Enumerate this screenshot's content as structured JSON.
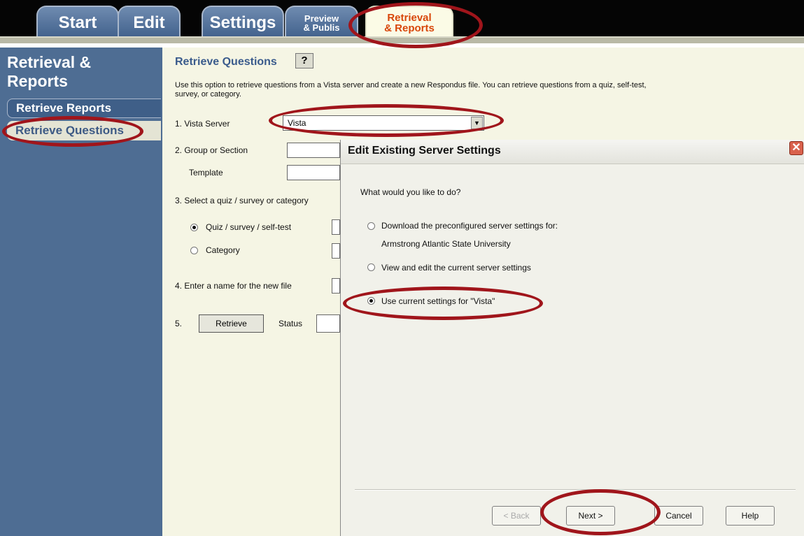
{
  "tabs": {
    "start": "Start",
    "edit": "Edit",
    "settings": "Settings",
    "preview_line1": "Preview",
    "preview_line2": "& Publis",
    "retrieval_line1": "Retrieval",
    "retrieval_line2": "& Reports"
  },
  "sidebar": {
    "heading_line1": "Retrieval &",
    "heading_line2": "Reports",
    "items": [
      {
        "label": "Retrieve Reports"
      },
      {
        "label": "Retrieve Questions"
      }
    ]
  },
  "main": {
    "title": "Retrieve Questions",
    "help": "?",
    "description": "Use this option to retrieve questions from a Vista server and create a new Respondus file.  You can retrieve questions from a quiz, self-test, survey, or category.",
    "vista_server_label": "1.  Vista Server",
    "vista_server_value": "Vista",
    "group_label": "2.  Group or Section",
    "template_label": "Template",
    "select_label": "3.  Select a quiz / survey or category",
    "quiz_label": "Quiz / survey / self-test",
    "category_label": "Category",
    "newfile_label": "4.  Enter a name for the new file",
    "step5_label": "5.",
    "retrieve_button": "Retrieve",
    "status_label": "Status"
  },
  "dialog": {
    "title": "Edit Existing Server Settings",
    "close": "✕",
    "prompt": "What would you like to do?",
    "option1_line1": "Download the preconfigured server settings for:",
    "option1_line2": "Armstrong Atlantic State University",
    "option2": "View and edit the current server settings",
    "option3": "Use current settings for \"Vista\"",
    "back_button": "< Back",
    "next_button": "Next >",
    "cancel_button": "Cancel",
    "help_button": "Help"
  },
  "colors": {
    "highlight": "#a0151b",
    "sidebar": "#4e6d93",
    "panel": "#f5f5e4"
  }
}
